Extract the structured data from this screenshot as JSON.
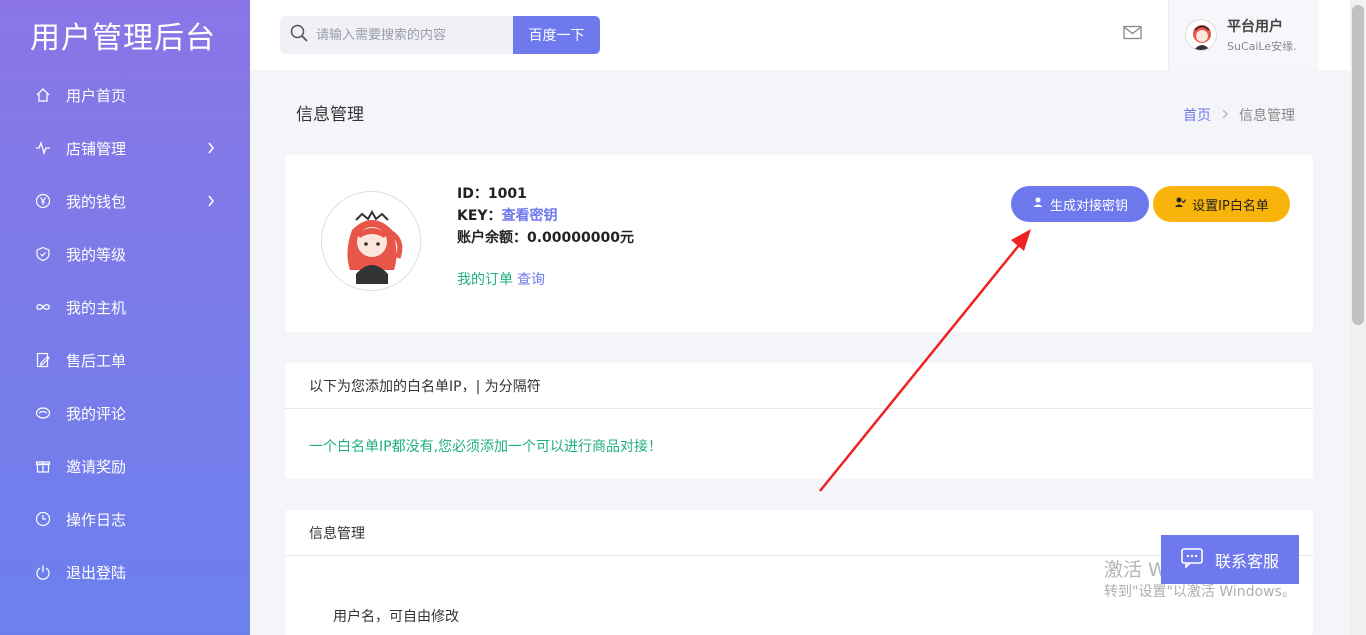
{
  "brand": "用户管理后台",
  "menu": [
    {
      "label": "用户首页",
      "icon": "home-icon",
      "arrow": false
    },
    {
      "label": "店铺管理",
      "icon": "pulse-icon",
      "arrow": true
    },
    {
      "label": "我的钱包",
      "icon": "yen-icon",
      "arrow": true
    },
    {
      "label": "我的等级",
      "icon": "shield-icon",
      "arrow": false
    },
    {
      "label": "我的主机",
      "icon": "infinity-icon",
      "arrow": false
    },
    {
      "label": "售后工单",
      "icon": "edit-doc-icon",
      "arrow": false
    },
    {
      "label": "我的评论",
      "icon": "comment-icon",
      "arrow": false
    },
    {
      "label": "邀请奖励",
      "icon": "gift-icon",
      "arrow": false
    },
    {
      "label": "操作日志",
      "icon": "clock-icon",
      "arrow": false
    },
    {
      "label": "退出登陆",
      "icon": "power-icon",
      "arrow": false
    }
  ],
  "search": {
    "placeholder": "请输入需要搜索的内容",
    "button": "百度一下"
  },
  "user": {
    "name": "平台用户",
    "subtitle": "SuCaiLe安缘."
  },
  "page": {
    "title": "信息管理",
    "breadcrumb_home": "首页",
    "breadcrumb_sep": ">",
    "breadcrumb_current": "信息管理"
  },
  "profile": {
    "id_label": "ID：",
    "id_value": "1001",
    "key_label": "KEY：",
    "key_link": "查看密钥",
    "balance_label": "账户余额：",
    "balance_value": "0.00000000元",
    "orders_label": "我的订单",
    "orders_query": "查询",
    "btn_generate": "生成对接密钥",
    "btn_whitelist": "设置IP白名单"
  },
  "whitelist": {
    "header": "以下为您添加的白名单IP，| 为分隔符",
    "empty_notice": "一个白名单IP都没有,您必须添加一个可以进行商品对接！"
  },
  "info_section": {
    "header": "信息管理",
    "username_label": "用户名，可自由修改"
  },
  "contact": {
    "label": "联系客服"
  },
  "watermark": {
    "line1": "激活 Windows",
    "line2": "转到\"设置\"以激活 Windows。"
  },
  "colors": {
    "accent": "#6f79ee",
    "warning": "#f8b40b",
    "success": "#20b07a",
    "annotation": "#ee2222"
  }
}
